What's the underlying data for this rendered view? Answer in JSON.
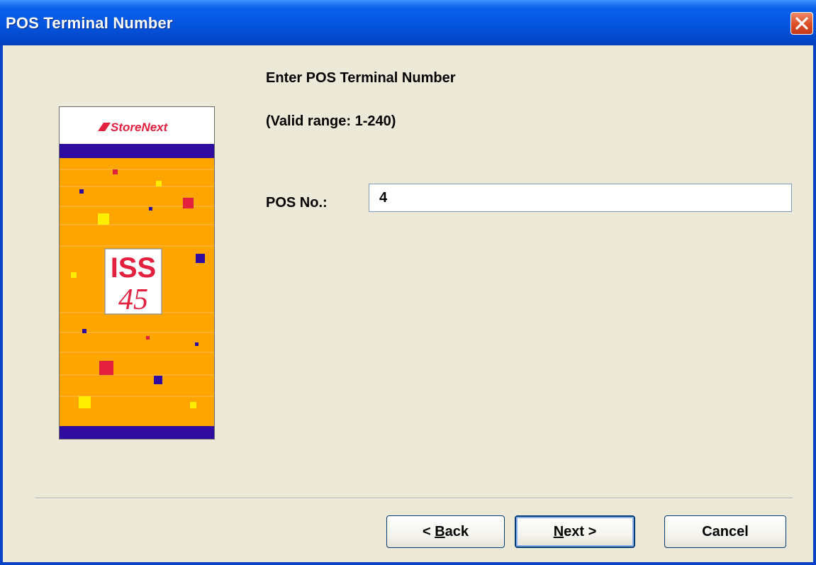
{
  "window": {
    "title": "POS Terminal Number"
  },
  "banner": {
    "brand": "StoreNext",
    "product_line1": "ISS",
    "product_line2": "45",
    "colors": {
      "orange": "#ffa500",
      "purple": "#2e0ca0",
      "red": "#e3203e",
      "yellow": "#ffee00"
    }
  },
  "form": {
    "heading": "Enter POS Terminal Number",
    "range_hint": "(Valid range: 1-240)",
    "pos_label": "POS No.:",
    "pos_value": "4"
  },
  "buttons": {
    "back": {
      "pre": "< ",
      "mnemonic": "B",
      "post": "ack"
    },
    "next": {
      "mnemonic": "N",
      "post": "ext >"
    },
    "cancel": "Cancel"
  },
  "colors": {
    "titlebar": "#0455e0",
    "dialog_bg": "#ece9d8",
    "close_button": "#dd4d24"
  }
}
